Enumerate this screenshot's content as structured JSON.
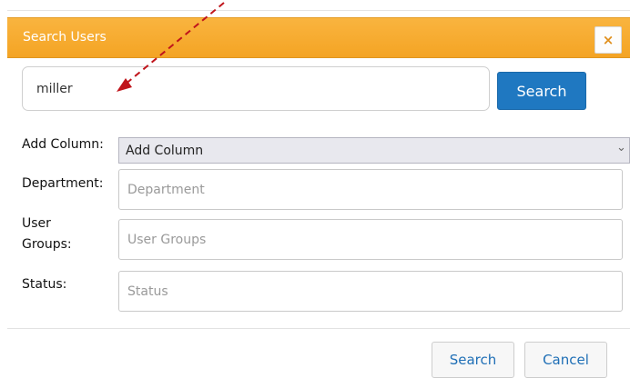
{
  "dialog": {
    "title": "Search Users",
    "close_label": "×"
  },
  "search": {
    "value": "miller",
    "button_label": "Search"
  },
  "filters": {
    "add_column": {
      "label": "Add Column:",
      "selected": "Add Column"
    },
    "department": {
      "label": "Department:",
      "placeholder": "Department"
    },
    "user_groups": {
      "label_line1": "User",
      "label_line2": "Groups:",
      "placeholder": "User Groups"
    },
    "status": {
      "label": "Status:",
      "placeholder": "Status"
    }
  },
  "footer": {
    "search_label": "Search",
    "cancel_label": "Cancel"
  },
  "colors": {
    "titlebar": "#f4a424",
    "primary_button": "#1f78c1",
    "annotation_arrow": "#c0141b"
  }
}
